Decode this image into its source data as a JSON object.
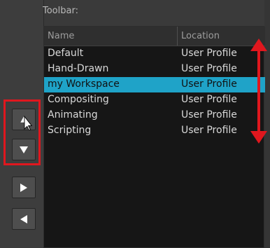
{
  "toolbar_label": "Toolbar:",
  "columns": {
    "name": "Name",
    "location": "Location"
  },
  "rows": [
    {
      "name": "Default",
      "location": "User Profile",
      "selected": false
    },
    {
      "name": "Hand-Drawn",
      "location": "User Profile",
      "selected": false
    },
    {
      "name": "my Workspace",
      "location": "User Profile",
      "selected": true
    },
    {
      "name": "Compositing",
      "location": "User Profile",
      "selected": false
    },
    {
      "name": "Animating",
      "location": "User Profile",
      "selected": false
    },
    {
      "name": "Scripting",
      "location": "User Profile",
      "selected": false
    }
  ],
  "buttons": {
    "move_up": "move-up-icon",
    "move_down": "move-down-icon",
    "add_to_toolbar": "arrow-right-icon",
    "remove_from_toolbar": "arrow-left-icon"
  },
  "colors": {
    "selection": "#1fa3c8",
    "annotation": "#e0171e"
  }
}
